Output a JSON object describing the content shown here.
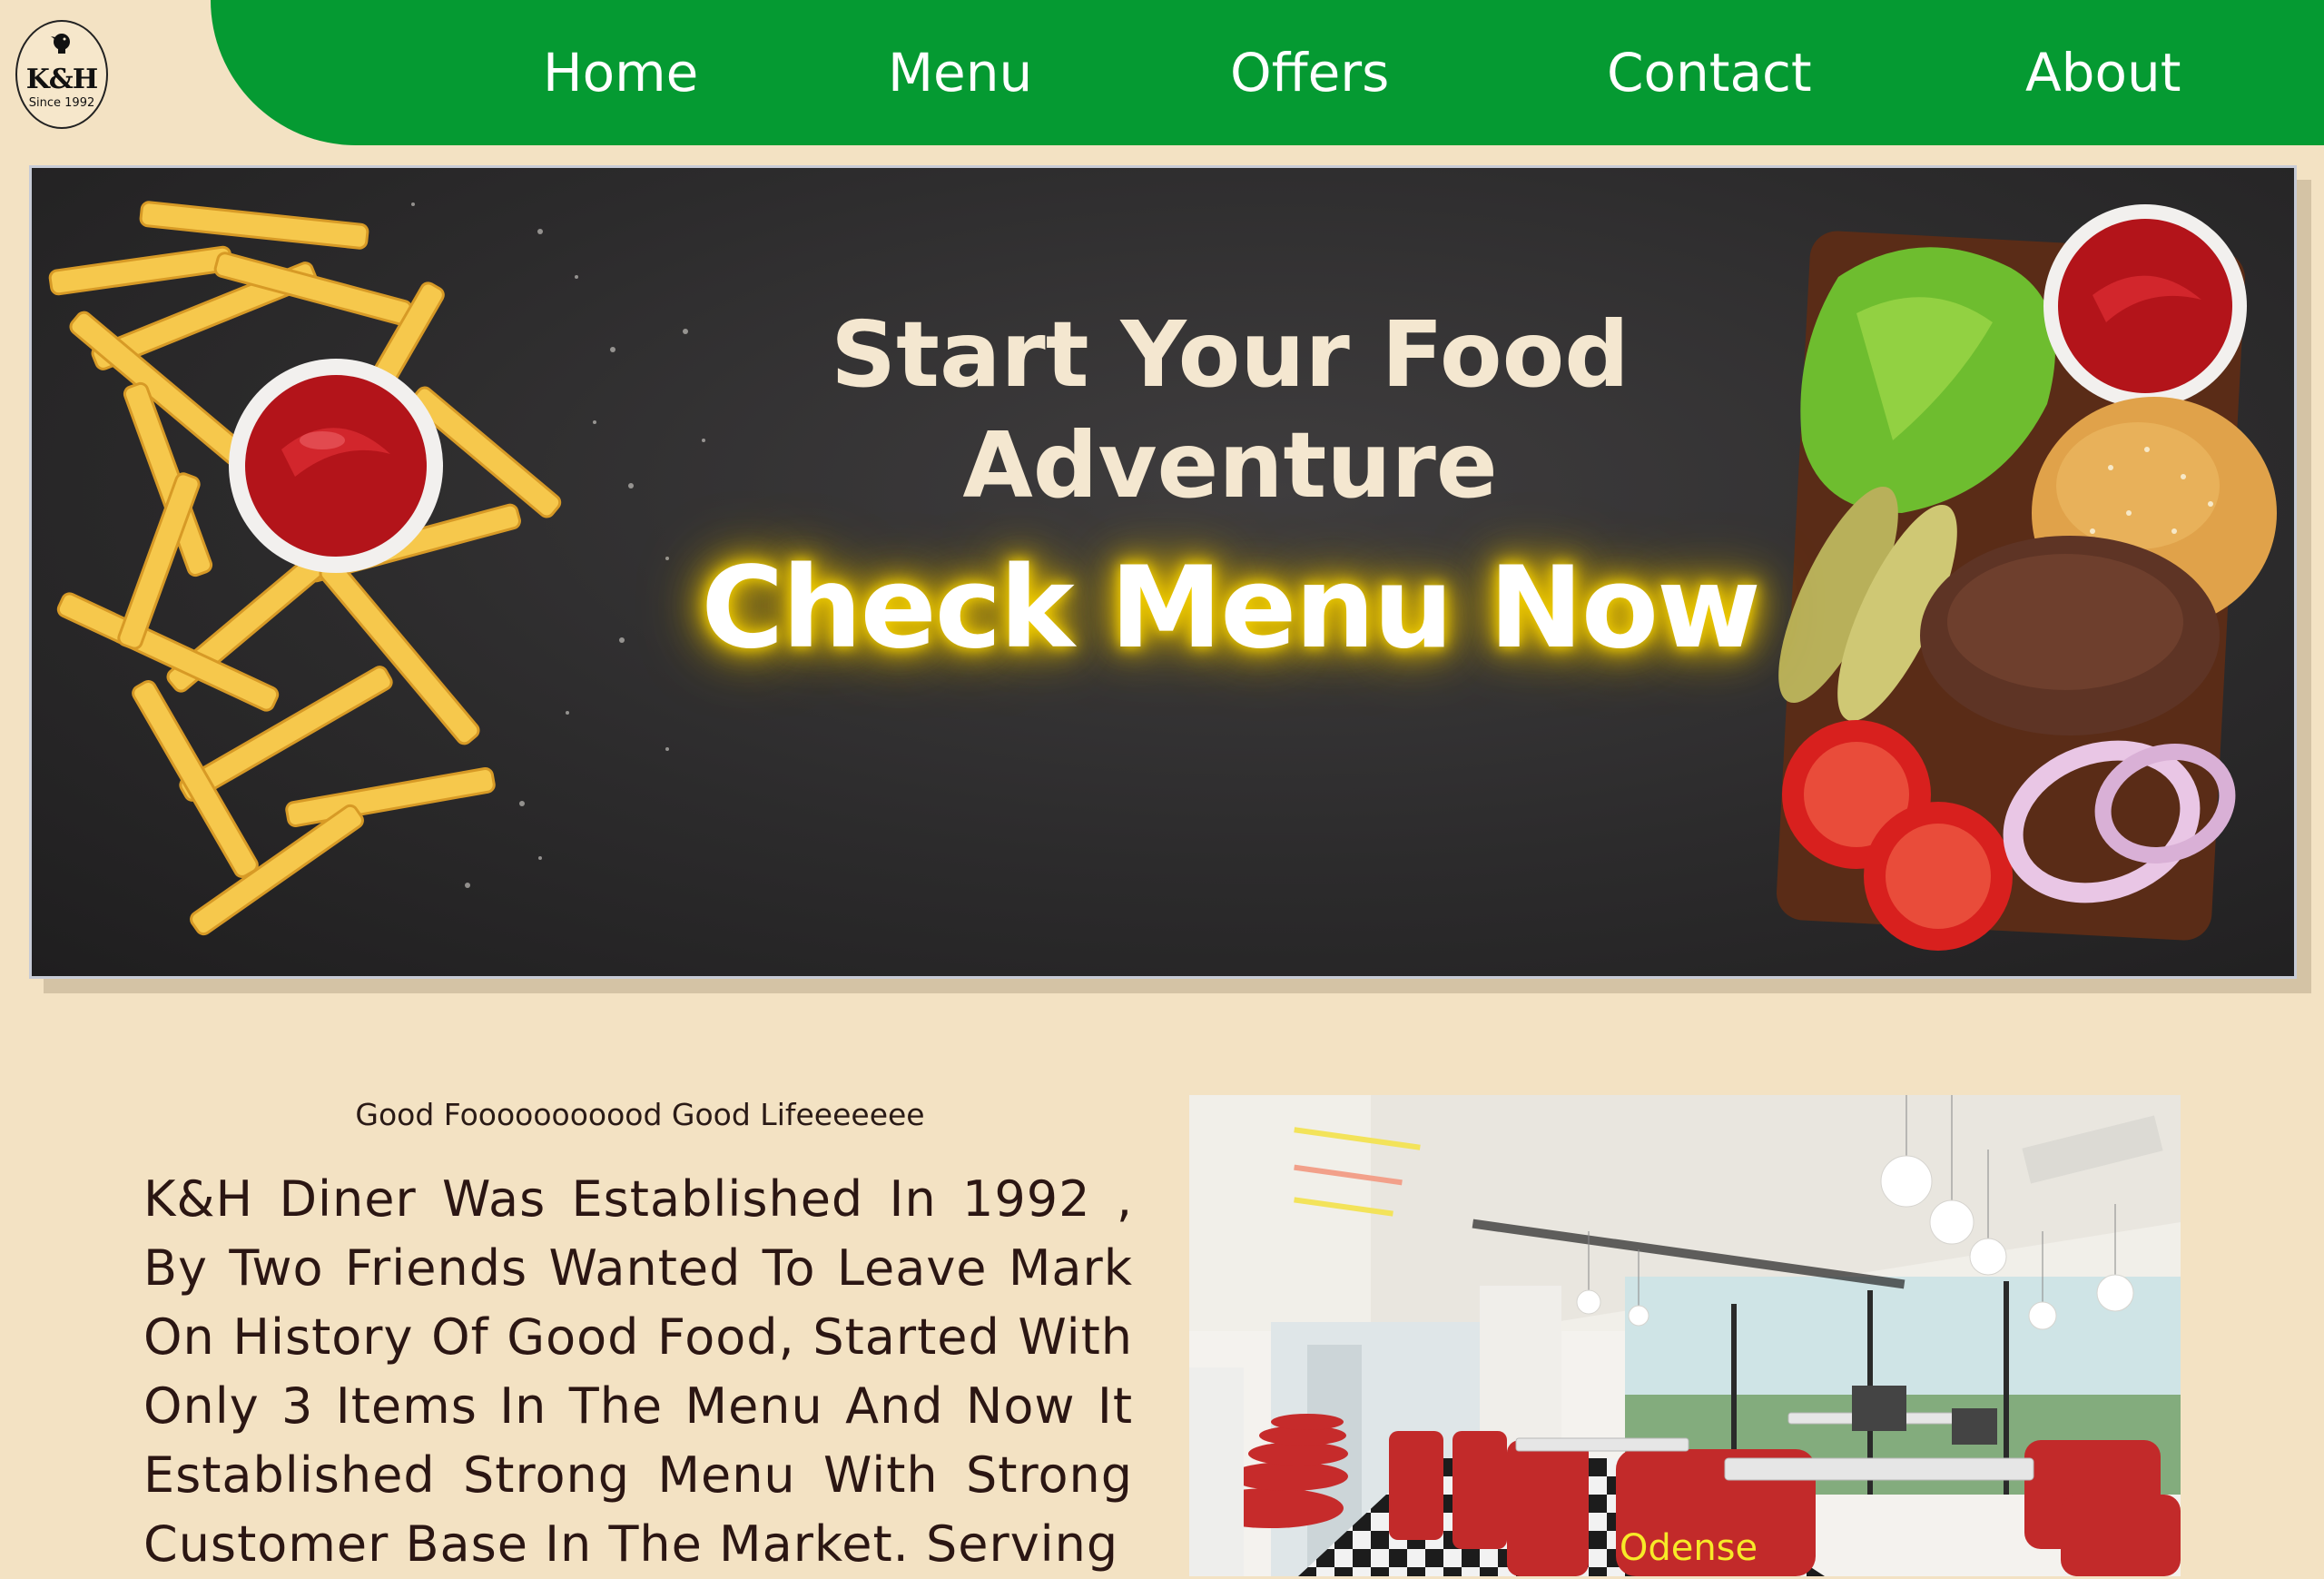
{
  "logo": {
    "brand": "K&H",
    "since": "Since 1992"
  },
  "nav": [
    {
      "label": "Home"
    },
    {
      "label": "Menu"
    },
    {
      "label": "Offers"
    },
    {
      "label": "Contact"
    },
    {
      "label": "About"
    }
  ],
  "hero": {
    "title_line1": "Start Your Food",
    "title_line2": "Adventure",
    "cta": "Check Menu Now"
  },
  "about": {
    "tagline": "Good Fooooooooood Good Lifeeeeeee",
    "paragraph": "K&H Diner Was Established In 1992 , By Two Friends Wanted To Leave Mark On History Of Good Food, Started With Only 3 Items In The Menu And Now It Established Strong Menu With Strong Customer Base In The Market. Serving",
    "image_caption": "Odense"
  },
  "colors": {
    "nav_green": "#059a32",
    "page_cream": "#f3e2c3",
    "cta_glow": "#f2d000",
    "caption_yellow": "#f7ea28"
  }
}
